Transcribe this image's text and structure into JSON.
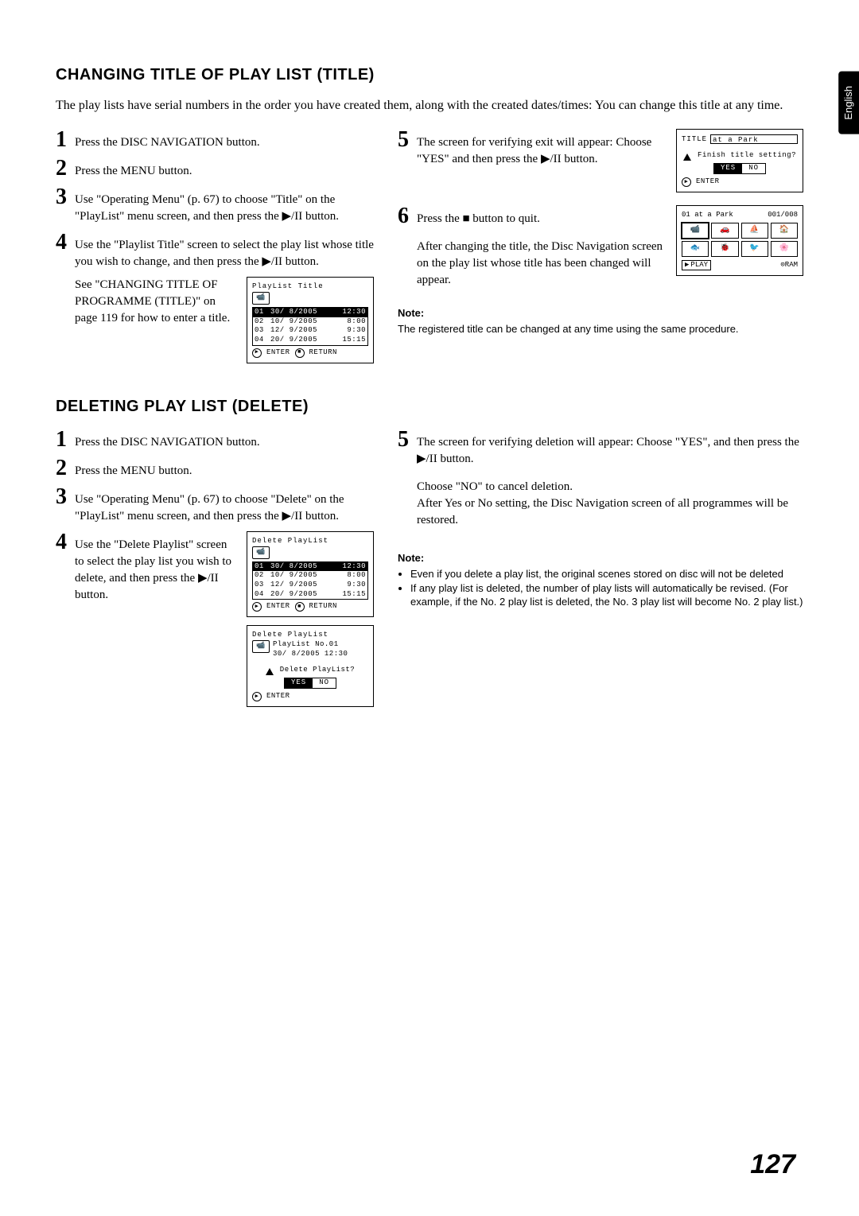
{
  "lang_tab": "English",
  "section1": {
    "heading": "CHANGING TITLE OF PLAY LIST (TITLE)",
    "intro": "The play lists have serial numbers in the order you have created them, along with the created dates/times: You can change this title at any time.",
    "steps_left": {
      "s1": "Press the DISC NAVIGATION button.",
      "s2": "Press the MENU button.",
      "s3": "Use \"Operating Menu\" (p. 67) to choose \"Title\" on the \"PlayList\" menu screen, and then press the ▶/II button.",
      "s4a": "Use the \"Playlist Title\" screen to select the play list whose title you wish to change, and then press the ▶/II button.",
      "s4b": "See \"CHANGING TITLE OF PROGRAMME (TITLE)\" on page 119 for how to enter a title."
    },
    "steps_right": {
      "s5": "The screen for verifying exit will appear: Choose \"YES\" and then press the ▶/II button.",
      "s6a": "Press the ■ button to quit.",
      "s6b": "After changing the title, the Disc Navigation screen on the play list whose title has been changed will appear."
    },
    "note_head": "Note:",
    "note_body": "The registered title can be changed at any time using the same procedure.",
    "osd_playlist_title": {
      "title": "PlayList Title",
      "rows": [
        {
          "n": "01",
          "d": "30/ 8/2005",
          "t": "12:30",
          "sel": true
        },
        {
          "n": "02",
          "d": "10/ 9/2005",
          "t": " 8:00",
          "sel": false
        },
        {
          "n": "03",
          "d": "12/ 9/2005",
          "t": " 9:30",
          "sel": false
        },
        {
          "n": "04",
          "d": "20/ 9/2005",
          "t": "15:15",
          "sel": false
        }
      ],
      "enter": "ENTER",
      "return": "RETURN"
    },
    "osd_confirm": {
      "label": "TITLE",
      "value": "at a Park",
      "question": "Finish title setting?",
      "yes": "YES",
      "no": "NO",
      "enter": "ENTER"
    },
    "osd_nav": {
      "header_left": "01 at a Park",
      "header_right": "001/008",
      "play": "PLAY",
      "badge": "RAM"
    }
  },
  "section2": {
    "heading": "DELETING PLAY LIST (DELETE)",
    "steps_left": {
      "s1": "Press the DISC NAVIGATION button.",
      "s2": "Press the MENU button.",
      "s3": "Use \"Operating Menu\" (p. 67) to choose \"Delete\" on the \"PlayList\" menu screen, and then press the ▶/II button.",
      "s4": "Use the \"Delete Playlist\" screen to select the play list you wish to delete, and then press the ▶/II button."
    },
    "steps_right": {
      "s5a": "The screen for verifying deletion will appear: Choose \"YES\", and then press the ▶/II button.",
      "s5b": "Choose \"NO\" to cancel deletion.",
      "s5c": "After Yes or No setting, the Disc Navigation screen of all programmes will be restored."
    },
    "note_head": "Note:",
    "note_bullets": [
      "Even if you delete a play list, the original scenes stored on disc will not be deleted",
      "If any play list is deleted, the number of play lists will automatically be revised. (For example, if the No. 2 play list is deleted, the No. 3 play list will become No. 2 play list.)"
    ],
    "osd_delete_list": {
      "title": "Delete PlayList",
      "rows": [
        {
          "n": "01",
          "d": "30/ 8/2005",
          "t": "12:30",
          "sel": true
        },
        {
          "n": "02",
          "d": "10/ 9/2005",
          "t": " 8:00",
          "sel": false
        },
        {
          "n": "03",
          "d": "12/ 9/2005",
          "t": " 9:30",
          "sel": false
        },
        {
          "n": "04",
          "d": "20/ 9/2005",
          "t": "15:15",
          "sel": false
        }
      ],
      "enter": "ENTER",
      "return": "RETURN"
    },
    "osd_delete_confirm": {
      "title": "Delete PlayList",
      "line1": "PlayList No.01",
      "line2": "30/ 8/2005 12:30",
      "question": "Delete PlayList?",
      "yes": "YES",
      "no": "NO",
      "enter": "ENTER"
    }
  },
  "page_number": "127"
}
